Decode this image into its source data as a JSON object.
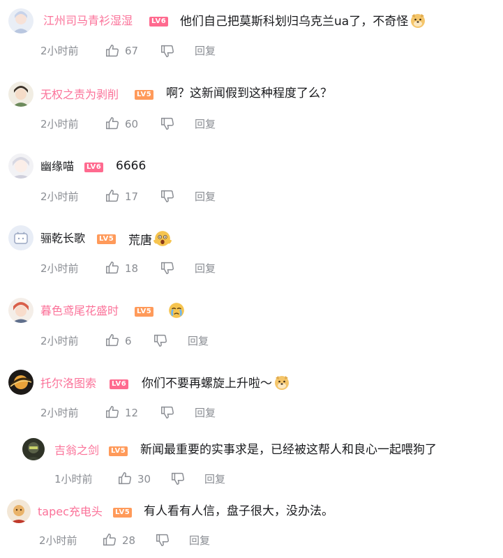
{
  "comments": [
    {
      "username": "江州司马青衫湿湿",
      "user_color": "#fb7299",
      "level": "LV6",
      "text": "他们自己把莫斯科划归乌克兰ua了，不奇怪",
      "emoji": "doge-face-icon",
      "time": "2小时前",
      "likes": "67",
      "reply": "回复"
    },
    {
      "username": "无权之责为剥削",
      "user_color": "#fb7299",
      "level": "LV5",
      "text": "啊？这新闻假到这种程度了么？",
      "emoji": "",
      "time": "2小时前",
      "likes": "60",
      "reply": "回复"
    },
    {
      "username": "幽缘喵",
      "user_color": "#18191c",
      "level": "LV6",
      "text": "6666",
      "emoji": "",
      "time": "2小时前",
      "likes": "17",
      "reply": "回复"
    },
    {
      "username": "骊乾长歌",
      "user_color": "#18191c",
      "level": "LV5",
      "text": "荒唐",
      "emoji": "shocked-face-icon",
      "time": "2小时前",
      "likes": "18",
      "reply": "回复"
    },
    {
      "username": "暮色鸢尾花盛时",
      "user_color": "#fb7299",
      "level": "LV5",
      "text": "",
      "emoji": "crying-face-icon",
      "time": "2小时前",
      "likes": "6",
      "reply": "回复"
    },
    {
      "username": "托尔洛图索",
      "user_color": "#fb7299",
      "level": "LV6",
      "text": "你们不要再螺旋上升啦～",
      "emoji": "doge-face-icon",
      "time": "2小时前",
      "likes": "12",
      "reply": "回复"
    },
    {
      "username": "吉翁之剑",
      "user_color": "#fb7299",
      "level": "LV5",
      "text": "新闻最重要的实事求是，已经被这帮人和良心一起喂狗了",
      "emoji": "",
      "time": "1小时前",
      "likes": "30",
      "reply": "回复"
    },
    {
      "username": "tapec充电头",
      "user_color": "#fb7299",
      "level": "LV5",
      "text": "有人看有人信，盘子很大，没办法。",
      "emoji": "",
      "time": "2小时前",
      "likes": "28",
      "reply": "回复"
    }
  ],
  "colors": {
    "accent": "#fb7299",
    "meta": "#8a8d93",
    "lv6": "#ff6a8f",
    "lv5": "#ff9a5a"
  }
}
